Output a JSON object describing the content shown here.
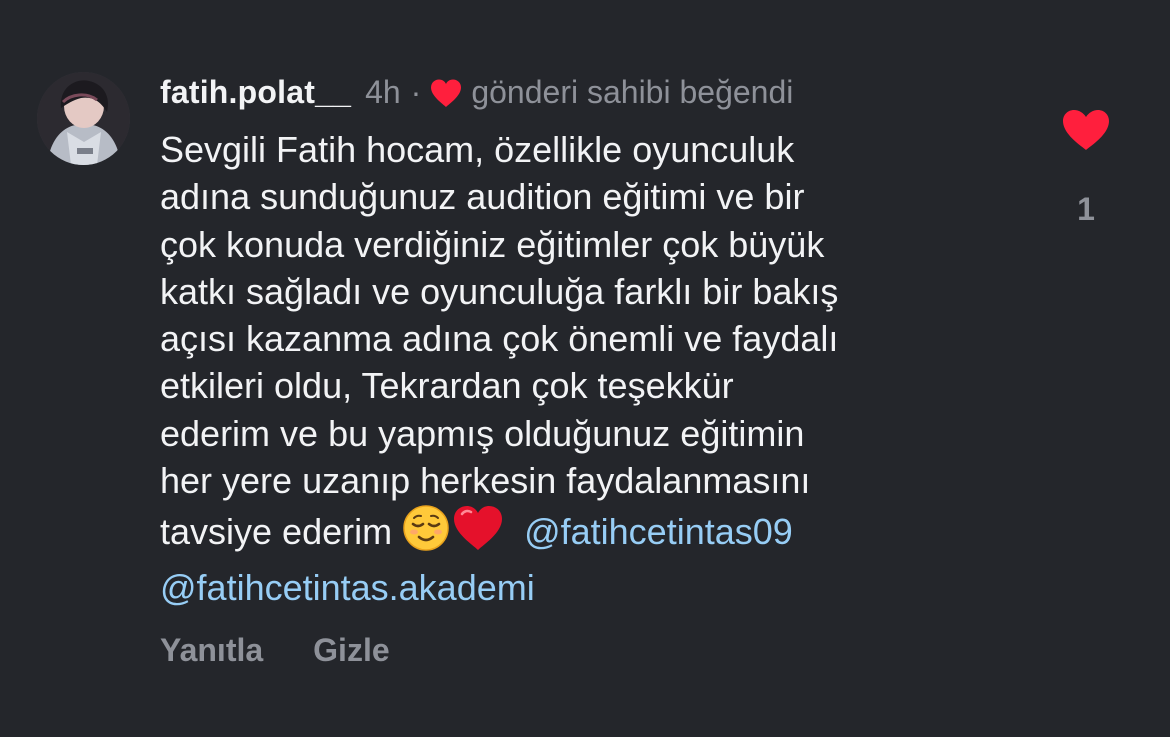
{
  "comment": {
    "username": "fatih.polat__",
    "time": "4h",
    "separator": "·",
    "owner_liked_text": "gönderi sahibi beğendi",
    "lines": [
      "Sevgili Fatih hocam, özellikle oyunculuk",
      "adına sunduğunuz audition eğitimi ve bir",
      "çok konuda verdiğiniz eğitimler çok büyük",
      "katkı sağladı ve oyunculuğa farklı bir bakış",
      "açısı kazanma adına çok önemli ve faydalı",
      "etkileri oldu, Tekrardan çok teşekkür",
      "ederim ve bu yapmış olduğunuz eğitimin",
      "her yere uzanıp herkesin faydalanmasını"
    ],
    "last_line_text": "tavsiye ederim ",
    "emojis": [
      "relieved-face",
      "red-heart"
    ],
    "mention_1": "@fatihcetintas09",
    "mention_2": "@fatihcetintas.akademi"
  },
  "actions": {
    "reply_label": "Yanıtla",
    "hide_label": "Gizle"
  },
  "likes": {
    "count": "1",
    "liked": true
  },
  "colors": {
    "background": "#24262b",
    "text": "#f2f3f5",
    "secondary": "#8e9199",
    "mention": "#97cdf5",
    "heart": "#ff3040"
  }
}
